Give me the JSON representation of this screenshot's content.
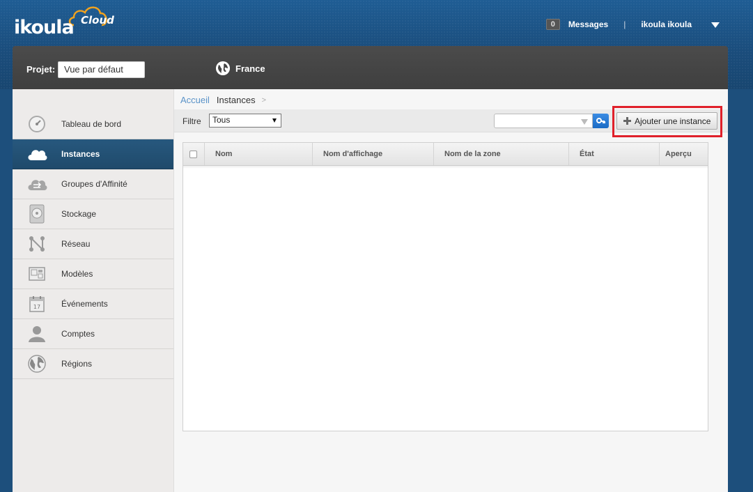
{
  "header": {
    "logo_text_main": "ikoula",
    "logo_text_cloud": "Cloud",
    "messages_count": "0",
    "messages_label": "Messages",
    "separator": "|",
    "user_name": "ikoula ikoula"
  },
  "project_bar": {
    "project_label": "Projet:",
    "project_value": "Vue par défaut",
    "region_label": "France"
  },
  "sidebar": {
    "items": [
      {
        "label": "Tableau de bord",
        "icon": "dashboard-icon",
        "active": false
      },
      {
        "label": "Instances",
        "icon": "cloud-icon",
        "active": true
      },
      {
        "label": "Groupes d'Affinité",
        "icon": "affinity-cloud-icon",
        "active": false
      },
      {
        "label": "Stockage",
        "icon": "disk-icon",
        "active": false
      },
      {
        "label": "Réseau",
        "icon": "network-icon",
        "active": false
      },
      {
        "label": "Modèles",
        "icon": "templates-icon",
        "active": false
      },
      {
        "label": "Événements",
        "icon": "calendar-icon",
        "active": false
      },
      {
        "label": "Comptes",
        "icon": "user-icon",
        "active": false
      },
      {
        "label": "Régions",
        "icon": "globe-icon",
        "active": false
      }
    ]
  },
  "breadcrumb": {
    "home": "Accueil",
    "current": "Instances",
    "arrow": ">"
  },
  "toolbar": {
    "filter_label": "Filtre",
    "filter_value": "Tous",
    "search_value": "",
    "add_button_label": "Ajouter une instance"
  },
  "table": {
    "columns": [
      "Nom",
      "Nom d'affichage",
      "Nom de la zone",
      "État",
      "Aperçu"
    ],
    "rows": []
  },
  "colors": {
    "header_blue": "#1a4c7b",
    "active_nav": "#1f4a6b",
    "highlight_red": "#e0202a",
    "link_blue": "#5a93c8"
  }
}
